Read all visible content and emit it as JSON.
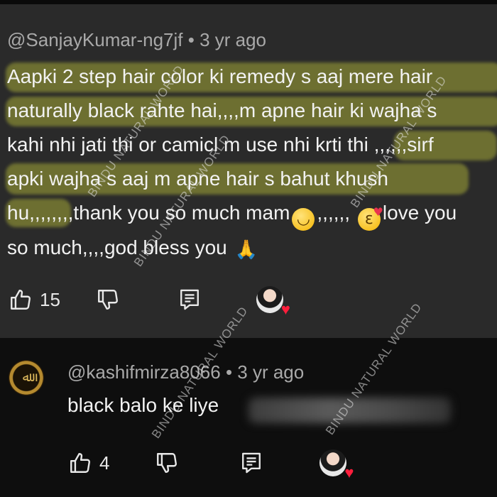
{
  "comment1": {
    "author": "@SanjayKumar-ng7jf",
    "time": "• 3 yr ago",
    "lines": [
      "Aapki 2 step hair color ki remedy s aaj mere hair",
      "naturally black rahte hai,,,,m apne hair ki wajha s",
      "kahi nhi jati thi or camicl m use nhi krti thi ,,,,,,sirf",
      "apki wajha s aaj m apne hair s bahut khush",
      "hu,,,,,,,,thank you so much mam",
      "so much,,,,god bless you"
    ],
    "line5_after_smile": ",,,,,,",
    "line5_after_kiss": "love you",
    "likes": "15"
  },
  "comment2": {
    "author": "@kashifmirza8066",
    "time": "• 3 yr ago",
    "text": "black balo ke liye",
    "likes": "4",
    "avatar_text": "ﷲ"
  },
  "watermark": "BINDU NATURAL WORLD",
  "icons": {
    "like": "thumbs-up-icon",
    "dislike": "thumbs-down-icon",
    "reply": "reply-comment-icon",
    "creator_heart": "creator-heart-avatar",
    "smile": "smiling-face-emoji",
    "kiss": "face-blowing-kiss-emoji",
    "pray": "folded-hands-emoji"
  },
  "colors": {
    "background": "#0e0e0e",
    "comment_bg": "#2a2a2a",
    "highlight": "#d2d73c",
    "heart": "#ff1e3c"
  }
}
